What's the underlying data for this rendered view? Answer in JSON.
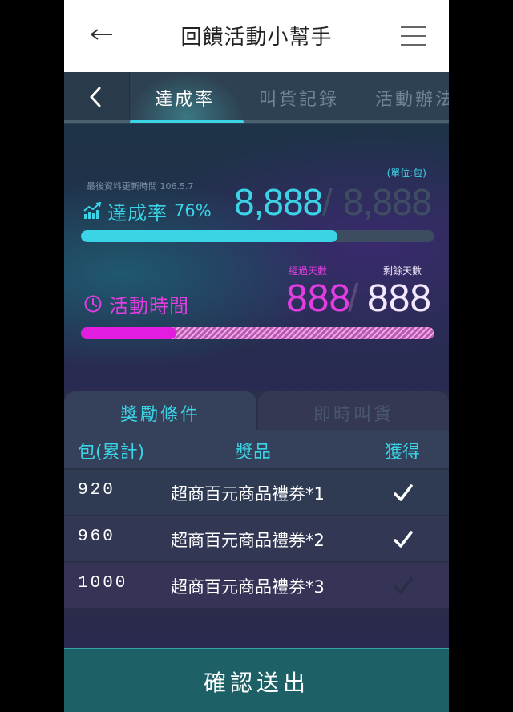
{
  "header": {
    "title": "回饋活動小幫手",
    "back_icon": "arrow-left-icon",
    "menu_icon": "hamburger-icon"
  },
  "tabs": [
    {
      "label": "達成率",
      "active": true
    },
    {
      "label": "叫貨記錄",
      "active": false
    },
    {
      "label": "活動辦法",
      "active": false
    }
  ],
  "achievement": {
    "unit": "(單位:包)",
    "updated": "最後資料更新時間 106.5.7",
    "label": "達成率",
    "percent": "76%",
    "progress": 0.725,
    "current": "8,888",
    "separator": "/",
    "target": "8,888",
    "icon": "trend-chart-icon"
  },
  "activity_time": {
    "label": "活動時間",
    "passed_label": "經過天數",
    "remaining_label": "剩餘天數",
    "passed_days": "888",
    "separator": "/",
    "remaining_days": "888",
    "progress": 0.27,
    "icon": "clock-icon"
  },
  "panel": {
    "tabs": [
      {
        "label": "獎勵條件",
        "active": true
      },
      {
        "label": "即時叫貨",
        "active": false
      }
    ],
    "headers": {
      "packs": "包(累計)",
      "prize": "獎品",
      "earned": "獲得"
    },
    "rows": [
      {
        "packs": "920",
        "prize": "超商百元商品禮券*1",
        "earned": true
      },
      {
        "packs": "960",
        "prize": "超商百元商品禮券*2",
        "earned": true
      },
      {
        "packs": "1000",
        "prize": "超商百元商品禮券*3",
        "earned": false
      }
    ]
  },
  "confirm_label": "確認送出",
  "colors": {
    "cyan": "#3ad4e6",
    "magenta": "#e21de0",
    "teal": "#1d6066"
  }
}
